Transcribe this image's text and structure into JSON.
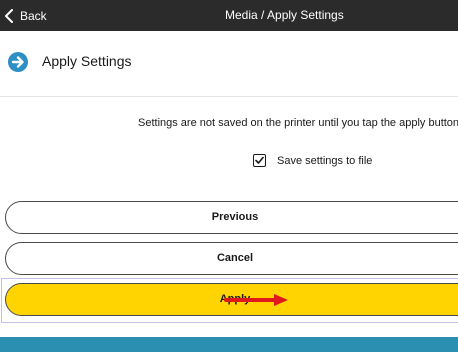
{
  "topbar": {
    "back_label": "Back",
    "title": "Media / Apply Settings",
    "background_color": "#2b2b2b"
  },
  "header": {
    "icon": "circle-arrow-right-icon",
    "icon_color": "#2d8fc4",
    "title": "Apply Settings"
  },
  "notice": {
    "text": "Settings are not saved on the printer until you tap the apply button be"
  },
  "save_to_file": {
    "label": "Save settings to file",
    "checked": true
  },
  "buttons": {
    "previous_label": "Previous",
    "cancel_label": "Cancel",
    "apply_label": "Apply",
    "apply_color": "#ffd400"
  },
  "annotation": {
    "arrow_color": "#e01a1a",
    "highlight_color": "#c8bfe8"
  },
  "footer": {
    "color": "#2a8fb0"
  }
}
